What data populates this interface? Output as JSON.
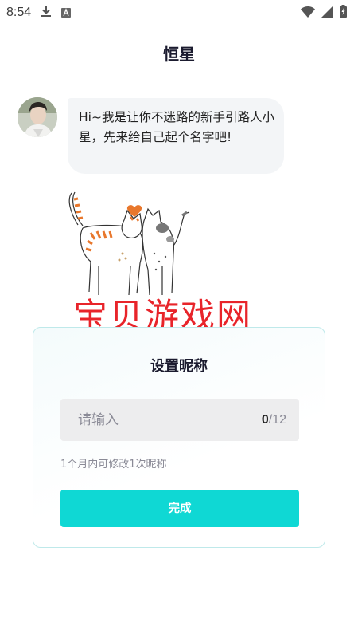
{
  "status_bar": {
    "time": "8:54",
    "icons": [
      "download-icon",
      "font-a-icon",
      "wifi-icon",
      "signal-icon",
      "battery-icon"
    ]
  },
  "header": {
    "title": "恒星"
  },
  "chat": {
    "message": "Hi~我是让你不迷路的新手引路人小星，先来给自己起个名字吧!"
  },
  "watermark": {
    "text": "宝贝游戏网"
  },
  "nickname_card": {
    "title": "设置昵称",
    "input_placeholder": "请输入",
    "input_value": "",
    "count_current": "0",
    "count_max": "/12",
    "hint": "1个月内可修改1次昵称",
    "submit_label": "完成"
  },
  "colors": {
    "accent": "#0fd8d4",
    "watermark": "#e8242a",
    "card_border": "#bfe9ea",
    "input_bg": "#ededee"
  }
}
